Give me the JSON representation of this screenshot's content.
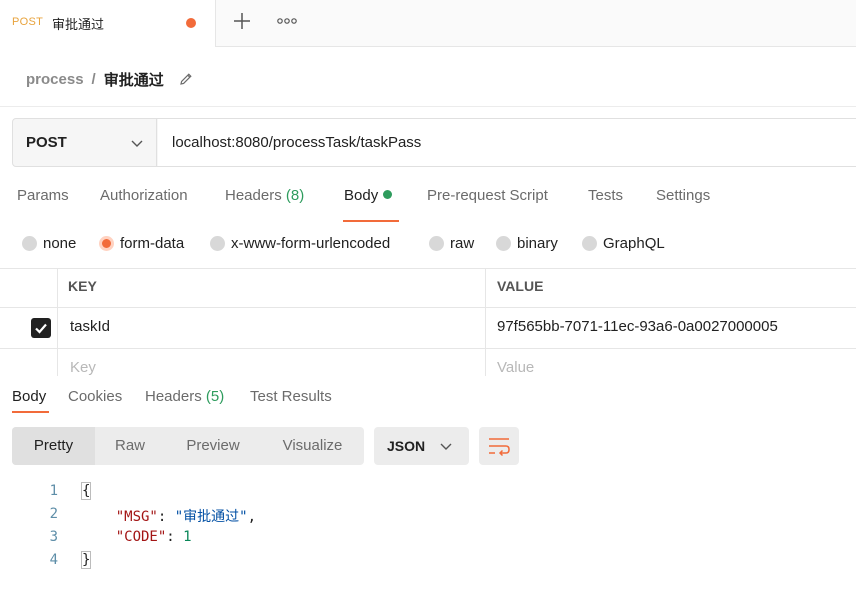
{
  "tab": {
    "method": "POST",
    "name": "审批通过"
  },
  "breadcrumb": {
    "collection": "process",
    "separator": "/",
    "request": "审批通过"
  },
  "request": {
    "method": "POST",
    "url": "localhost:8080/processTask/taskPass"
  },
  "request_tabs": {
    "params": "Params",
    "authorization": "Authorization",
    "headers": "Headers",
    "headers_count": "(8)",
    "body": "Body",
    "prerequest": "Pre-request Script",
    "tests": "Tests",
    "settings": "Settings"
  },
  "body_types": [
    {
      "label": "none",
      "selected": false
    },
    {
      "label": "form-data",
      "selected": true
    },
    {
      "label": "x-www-form-urlencoded",
      "selected": false
    },
    {
      "label": "raw",
      "selected": false
    },
    {
      "label": "binary",
      "selected": false
    },
    {
      "label": "GraphQL",
      "selected": false
    }
  ],
  "params_table": {
    "key_header": "KEY",
    "value_header": "VALUE",
    "rows": [
      {
        "checked": true,
        "key": "taskId",
        "value": "97f565bb-7071-11ec-93a6-0a0027000005"
      }
    ],
    "new_key_placeholder": "Key",
    "new_value_placeholder": "Value"
  },
  "response_tabs": {
    "body": "Body",
    "cookies": "Cookies",
    "headers": "Headers",
    "headers_count": "(5)",
    "test_results": "Test Results"
  },
  "response_view": {
    "pretty": "Pretty",
    "raw": "Raw",
    "preview": "Preview",
    "visualize": "Visualize",
    "format": "JSON"
  },
  "response_code": {
    "line_numbers": [
      "1",
      "2",
      "3",
      "4"
    ],
    "open_brace": "{",
    "key1": "\"MSG\"",
    "val1": "\"审批通过\"",
    "key2": "\"CODE\"",
    "val2": "1",
    "close_brace": "}"
  },
  "colors": {
    "accent": "#f26b3a",
    "green": "#2e9c5d",
    "method_orange": "#e8a33d"
  },
  "icons": [
    "plus-icon",
    "more-icon",
    "pencil-icon",
    "chevron-down-icon",
    "checkbox-checked-icon",
    "wrap-lines-icon"
  ]
}
